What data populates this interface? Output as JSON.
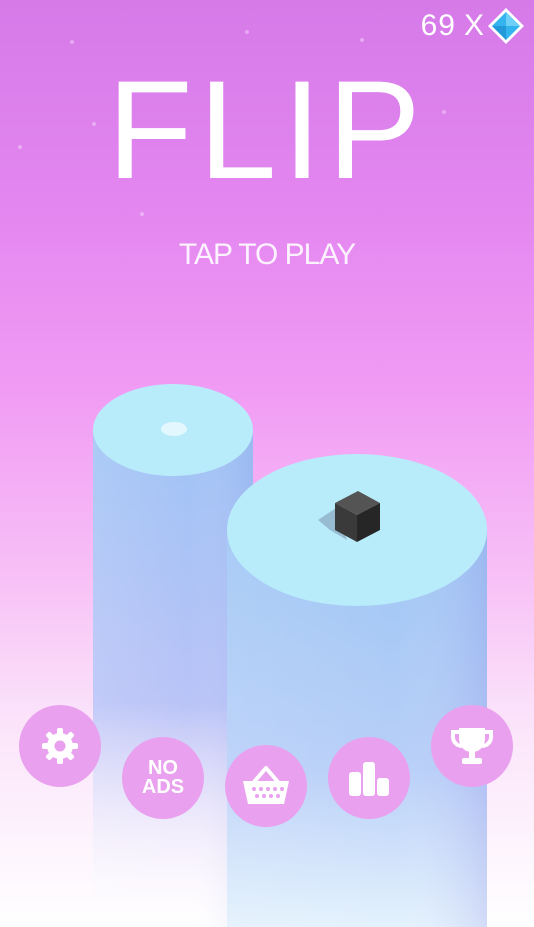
{
  "hud": {
    "gem_count": "69",
    "gem_multiplier": "X",
    "gem_icon": "diamond-icon",
    "gem_color": "#37b8f0"
  },
  "title": "FLIP",
  "prompt": "TAP TO PLAY",
  "scene": {
    "pillar_top_color": "#b8ecfa",
    "pillar_side_color": "#9ec4f4",
    "cube_color": "#333333"
  },
  "menu": {
    "button_color": "#e9a0ee",
    "settings": {
      "icon": "gear-icon"
    },
    "no_ads": {
      "line1": "NO",
      "line2": "ADS"
    },
    "shop": {
      "icon": "basket-icon"
    },
    "leaderboard": {
      "icon": "bar-chart-icon"
    },
    "achievements": {
      "icon": "trophy-icon"
    }
  }
}
